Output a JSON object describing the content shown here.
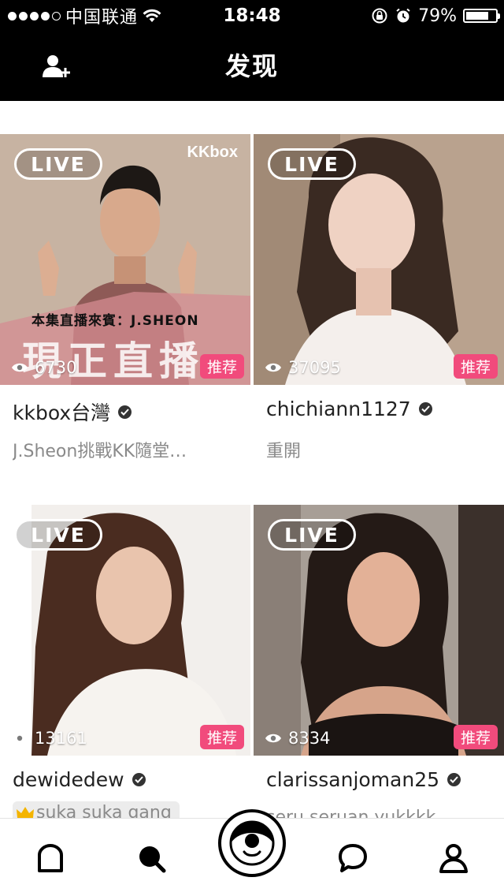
{
  "status_bar": {
    "carrier": "中国联通",
    "time": "18:48",
    "battery": "79%",
    "battery_level": 0.79
  },
  "nav": {
    "title": "发现",
    "add_friend_icon": "add-user-icon"
  },
  "live_label": "LIVE",
  "recommend_label": "推荐",
  "cards": [
    {
      "name": "kkbox台灣",
      "desc": "J.Sheon挑戰KK隨堂…",
      "viewers": "6730",
      "overlay_brand": "KKbox",
      "overlay_guest": "本集直播來賓：J.SHEON",
      "overlay_headline": "現正直播"
    },
    {
      "name": "chichiann1127",
      "desc": "重開",
      "viewers": "37095"
    },
    {
      "name": "dewidedew",
      "desc": "suka suka gang",
      "viewers": "13161"
    },
    {
      "name": "clarissanjoman25",
      "desc": "seru seruan yukkkk",
      "viewers": "8334"
    }
  ],
  "tabs": [
    {
      "icon": "home-icon"
    },
    {
      "icon": "search-icon"
    },
    {
      "icon": "live-camera-icon"
    },
    {
      "icon": "chat-icon"
    },
    {
      "icon": "profile-icon"
    }
  ],
  "colors": {
    "accent_pink": "#f14b7c",
    "header_bg": "#000000"
  }
}
